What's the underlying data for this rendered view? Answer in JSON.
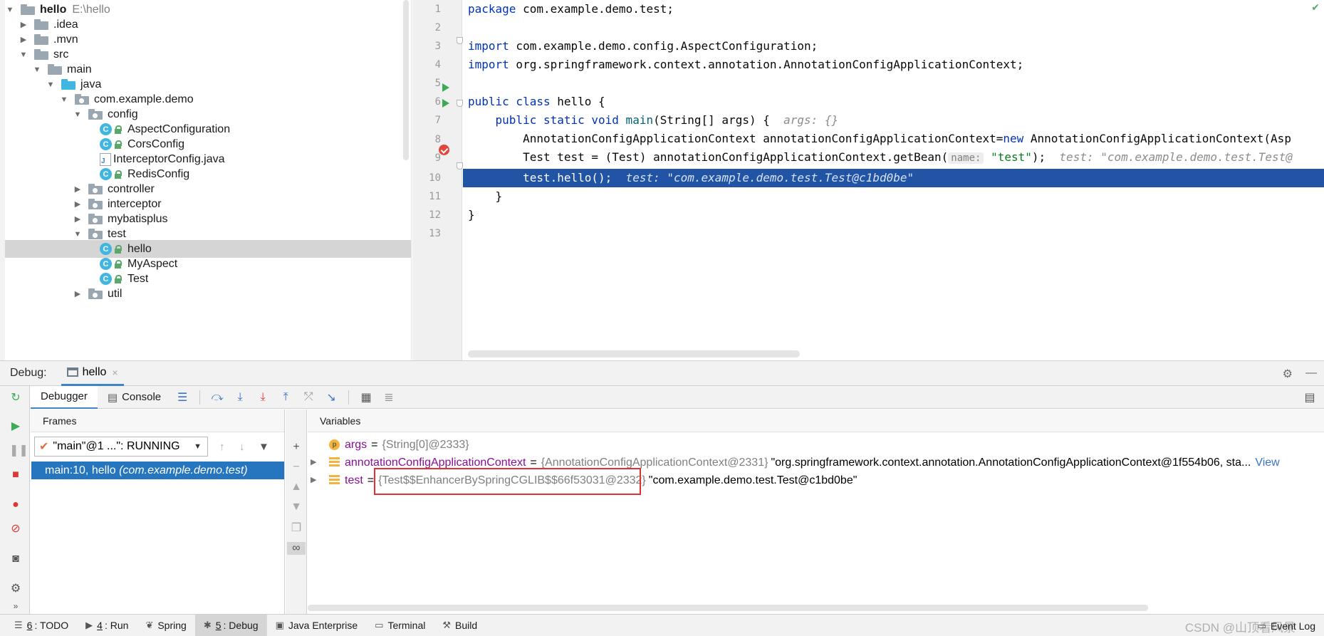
{
  "tree": {
    "items": [
      {
        "label": "hello",
        "extra": "E:\\hello",
        "arrow": "▼",
        "icon": "folder",
        "depth": 0,
        "bold": true
      },
      {
        "label": ".idea",
        "arrow": "▶",
        "icon": "folder",
        "depth": 1
      },
      {
        "label": ".mvn",
        "arrow": "▶",
        "icon": "folder",
        "depth": 1
      },
      {
        "label": "src",
        "arrow": "▼",
        "icon": "folder",
        "depth": 1
      },
      {
        "label": "main",
        "arrow": "▼",
        "icon": "folder",
        "depth": 2
      },
      {
        "label": "java",
        "arrow": "▼",
        "icon": "folder-blue",
        "depth": 3
      },
      {
        "label": "com.example.demo",
        "arrow": "▼",
        "icon": "package",
        "depth": 4
      },
      {
        "label": "config",
        "arrow": "▼",
        "icon": "package",
        "depth": 5
      },
      {
        "label": "AspectConfiguration",
        "icon": "class",
        "depth": 7
      },
      {
        "label": "CorsConfig",
        "icon": "class",
        "depth": 7
      },
      {
        "label": "InterceptorConfig.java",
        "icon": "java-file",
        "depth": 7
      },
      {
        "label": "RedisConfig",
        "icon": "class",
        "depth": 7
      },
      {
        "label": "controller",
        "arrow": "▶",
        "icon": "package",
        "depth": 5
      },
      {
        "label": "interceptor",
        "arrow": "▶",
        "icon": "package",
        "depth": 5
      },
      {
        "label": "mybatisplus",
        "arrow": "▶",
        "icon": "package",
        "depth": 5
      },
      {
        "label": "test",
        "arrow": "▼",
        "icon": "package",
        "depth": 5
      },
      {
        "label": "hello",
        "icon": "class",
        "depth": 7,
        "selected": true
      },
      {
        "label": "MyAspect",
        "icon": "class",
        "depth": 7
      },
      {
        "label": "Test",
        "icon": "class",
        "depth": 7
      },
      {
        "label": "util",
        "arrow": "▶",
        "icon": "package",
        "depth": 5
      }
    ],
    "class_letter": "C",
    "java_file_letter": "J"
  },
  "editor": {
    "line_numbers": [
      "1",
      "2",
      "3",
      "4",
      "5",
      "6",
      "7",
      "8",
      "9",
      "10",
      "11",
      "12",
      "13"
    ],
    "line1": {
      "kw": "package",
      "rest": " com.example.demo.test;"
    },
    "line3": {
      "kw": "import",
      "rest": " com.example.demo.config.AspectConfiguration;"
    },
    "line4": {
      "kw": "import",
      "rest": " org.springframework.context.annotation.AnnotationConfigApplicationContext;"
    },
    "line6": {
      "kw": "public class",
      "rest": " hello {"
    },
    "line7": {
      "indent": "    ",
      "kw": "public static void",
      "fn": " main",
      "rest": "(String[] args) {",
      "hint": "args: {}"
    },
    "line8": {
      "indent": "        ",
      "a": "AnnotationConfigApplicationContext annotationConfigApplicationContext=",
      "kw": "new",
      "b": " AnnotationConfigApplicationContext(Asp"
    },
    "line9": {
      "indent": "        ",
      "a": "Test test = (Test) annotationConfigApplicationContext.getBean(",
      "param": "name:",
      "str": "\"test\"",
      "b": ");",
      "hint": "test: \"com.example.demo.test.Test@"
    },
    "line10": {
      "indent": "        ",
      "a": "test.hello();",
      "hint": "test: \"com.example.demo.test.Test@c1bd0be\""
    },
    "line11": {
      "indent": "    ",
      "a": "}"
    },
    "line12": {
      "a": "}"
    },
    "check": "✔"
  },
  "debug": {
    "title": "Debug:",
    "tab_label": "hello",
    "tab_close": "×",
    "settings_icon": "⚙",
    "minimize_icon": "—",
    "debugger_tab": "Debugger",
    "console_tab": "Console",
    "frames_header": "Frames",
    "variables_header": "Variables",
    "thread_label": "\"main\"@1 ...\": RUNNING",
    "frame_label": "main:10, hello",
    "frame_pkg": "(com.example.demo.test)",
    "variables": [
      {
        "name": "args",
        "type": "{String[0]@2333}",
        "value": "",
        "icon": "p",
        "expandable": false
      },
      {
        "name": "annotationConfigApplicationContext",
        "type": "{AnnotationConfigApplicationContext@2331}",
        "value": "\"org.springframework.context.annotation.AnnotationConfigApplicationContext@1f554b06, sta...",
        "link": "View",
        "icon": "f",
        "expandable": true
      },
      {
        "name": "test",
        "type": "{Test$$EnhancerBySpringCGLIB$$66f53031@2332}",
        "value": "\"com.example.demo.test.Test@c1bd0be\"",
        "icon": "f",
        "expandable": true
      }
    ],
    "equals": "="
  },
  "statusbar": {
    "items": [
      {
        "num": "6",
        "label": ": TODO",
        "icon": "☰"
      },
      {
        "num": "4",
        "label": ": Run",
        "icon": "▶"
      },
      {
        "num": "",
        "label": "Spring",
        "icon": "❦"
      },
      {
        "num": "5",
        "label": ": Debug",
        "icon": "✱",
        "active": true
      },
      {
        "num": "",
        "label": "Java Enterprise",
        "icon": "▣"
      },
      {
        "num": "",
        "label": "Terminal",
        "icon": "▭"
      },
      {
        "num": "",
        "label": "Build",
        "icon": "⚒"
      }
    ],
    "event_log": "Event Log",
    "watermark": "CSDN @山顶看风景"
  }
}
